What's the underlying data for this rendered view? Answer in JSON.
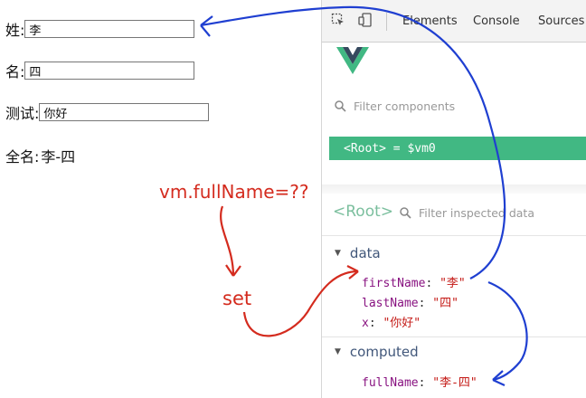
{
  "form": {
    "surname_label": "姓:",
    "surname_value": "李",
    "given_label": "名:",
    "given_value": "四",
    "test_label": "测试:",
    "test_value": "你好",
    "fullname_label": "全名:",
    "fullname_value": "李-四"
  },
  "devtools": {
    "tabs": [
      "Elements",
      "Console",
      "Sources"
    ],
    "filter_components": "Filter components",
    "root_item": "<Root> = $vm0",
    "inspect_root": "<Root>",
    "filter_inspected": "Filter inspected data",
    "data_section": "data",
    "data_props": [
      {
        "key": "firstName",
        "value": "\"李\""
      },
      {
        "key": "lastName",
        "value": "\"四\""
      },
      {
        "key": "x",
        "value": "\"你好\""
      }
    ],
    "computed_section": "computed",
    "computed_props": [
      {
        "key": "fullName",
        "value": "\"李-四\""
      }
    ]
  },
  "annotations": {
    "vm_expression": "vm.fullName=??",
    "set_label": "set"
  },
  "colors": {
    "vue_green": "#41b883",
    "annotation_red": "#d42b1e",
    "annotation_blue": "#1f3fd1"
  }
}
